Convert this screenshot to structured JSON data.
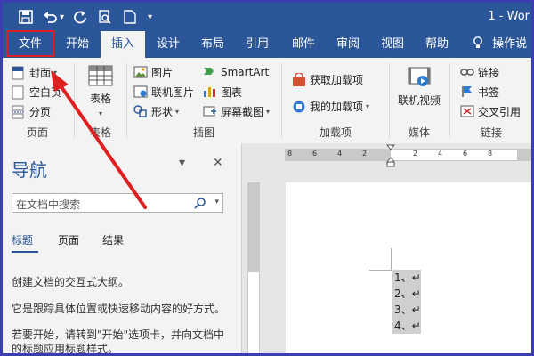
{
  "window": {
    "title": "1 - Wor"
  },
  "qat": {
    "icons": [
      "save-icon",
      "undo-icon",
      "redo-icon",
      "print-preview-icon",
      "new-doc-icon",
      "customize-qat-icon"
    ],
    "undo_dd": "▾",
    "more": "▾"
  },
  "tabs": [
    {
      "label": "文件"
    },
    {
      "label": "开始"
    },
    {
      "label": "插入"
    },
    {
      "label": "设计"
    },
    {
      "label": "布局"
    },
    {
      "label": "引用"
    },
    {
      "label": "邮件"
    },
    {
      "label": "审阅"
    },
    {
      "label": "视图"
    },
    {
      "label": "帮助"
    }
  ],
  "tellme": {
    "label": "操作说"
  },
  "ribbon": {
    "pages": {
      "cover": "封面",
      "blank": "空白页",
      "break": "分页",
      "label": "页面"
    },
    "tables": {
      "table": "表格",
      "label": "表格"
    },
    "illustrations": {
      "pictures": "图片",
      "online_pictures": "联机图片",
      "shapes": "形状",
      "smartart": "SmartArt",
      "chart": "图表",
      "screenshot": "屏幕截图",
      "label": "插图"
    },
    "addins": {
      "get": "获取加载项",
      "my": "我的加载项",
      "label": "加载项"
    },
    "media": {
      "online_video": "联机视频",
      "label": "媒体"
    },
    "links": {
      "link": "链接",
      "bookmark": "书签",
      "cross_ref": "交叉引用",
      "label": "链接"
    }
  },
  "nav": {
    "title": "导航",
    "search_placeholder": "在文档中搜索",
    "tabs": [
      {
        "label": "标题"
      },
      {
        "label": "页面"
      },
      {
        "label": "结果"
      }
    ],
    "p1": "创建文档的交互式大纲。",
    "p2": "它是跟踪具体位置或快速移动内容的好方式。",
    "p3": "若要开始，请转到\"开始\"选项卡，并向文档中的标题应用标题样式。"
  },
  "ruler": {
    "numbers": [
      "8",
      "6",
      "4",
      "2",
      "",
      "2",
      "4",
      "6",
      "8"
    ]
  },
  "doc": {
    "lines": [
      "1、↵",
      "2、↵",
      "3、↵",
      "4、↵"
    ]
  },
  "colors": {
    "accent": "#2b579a",
    "annotation": "#e02020",
    "frame": "#3a3fb0"
  }
}
